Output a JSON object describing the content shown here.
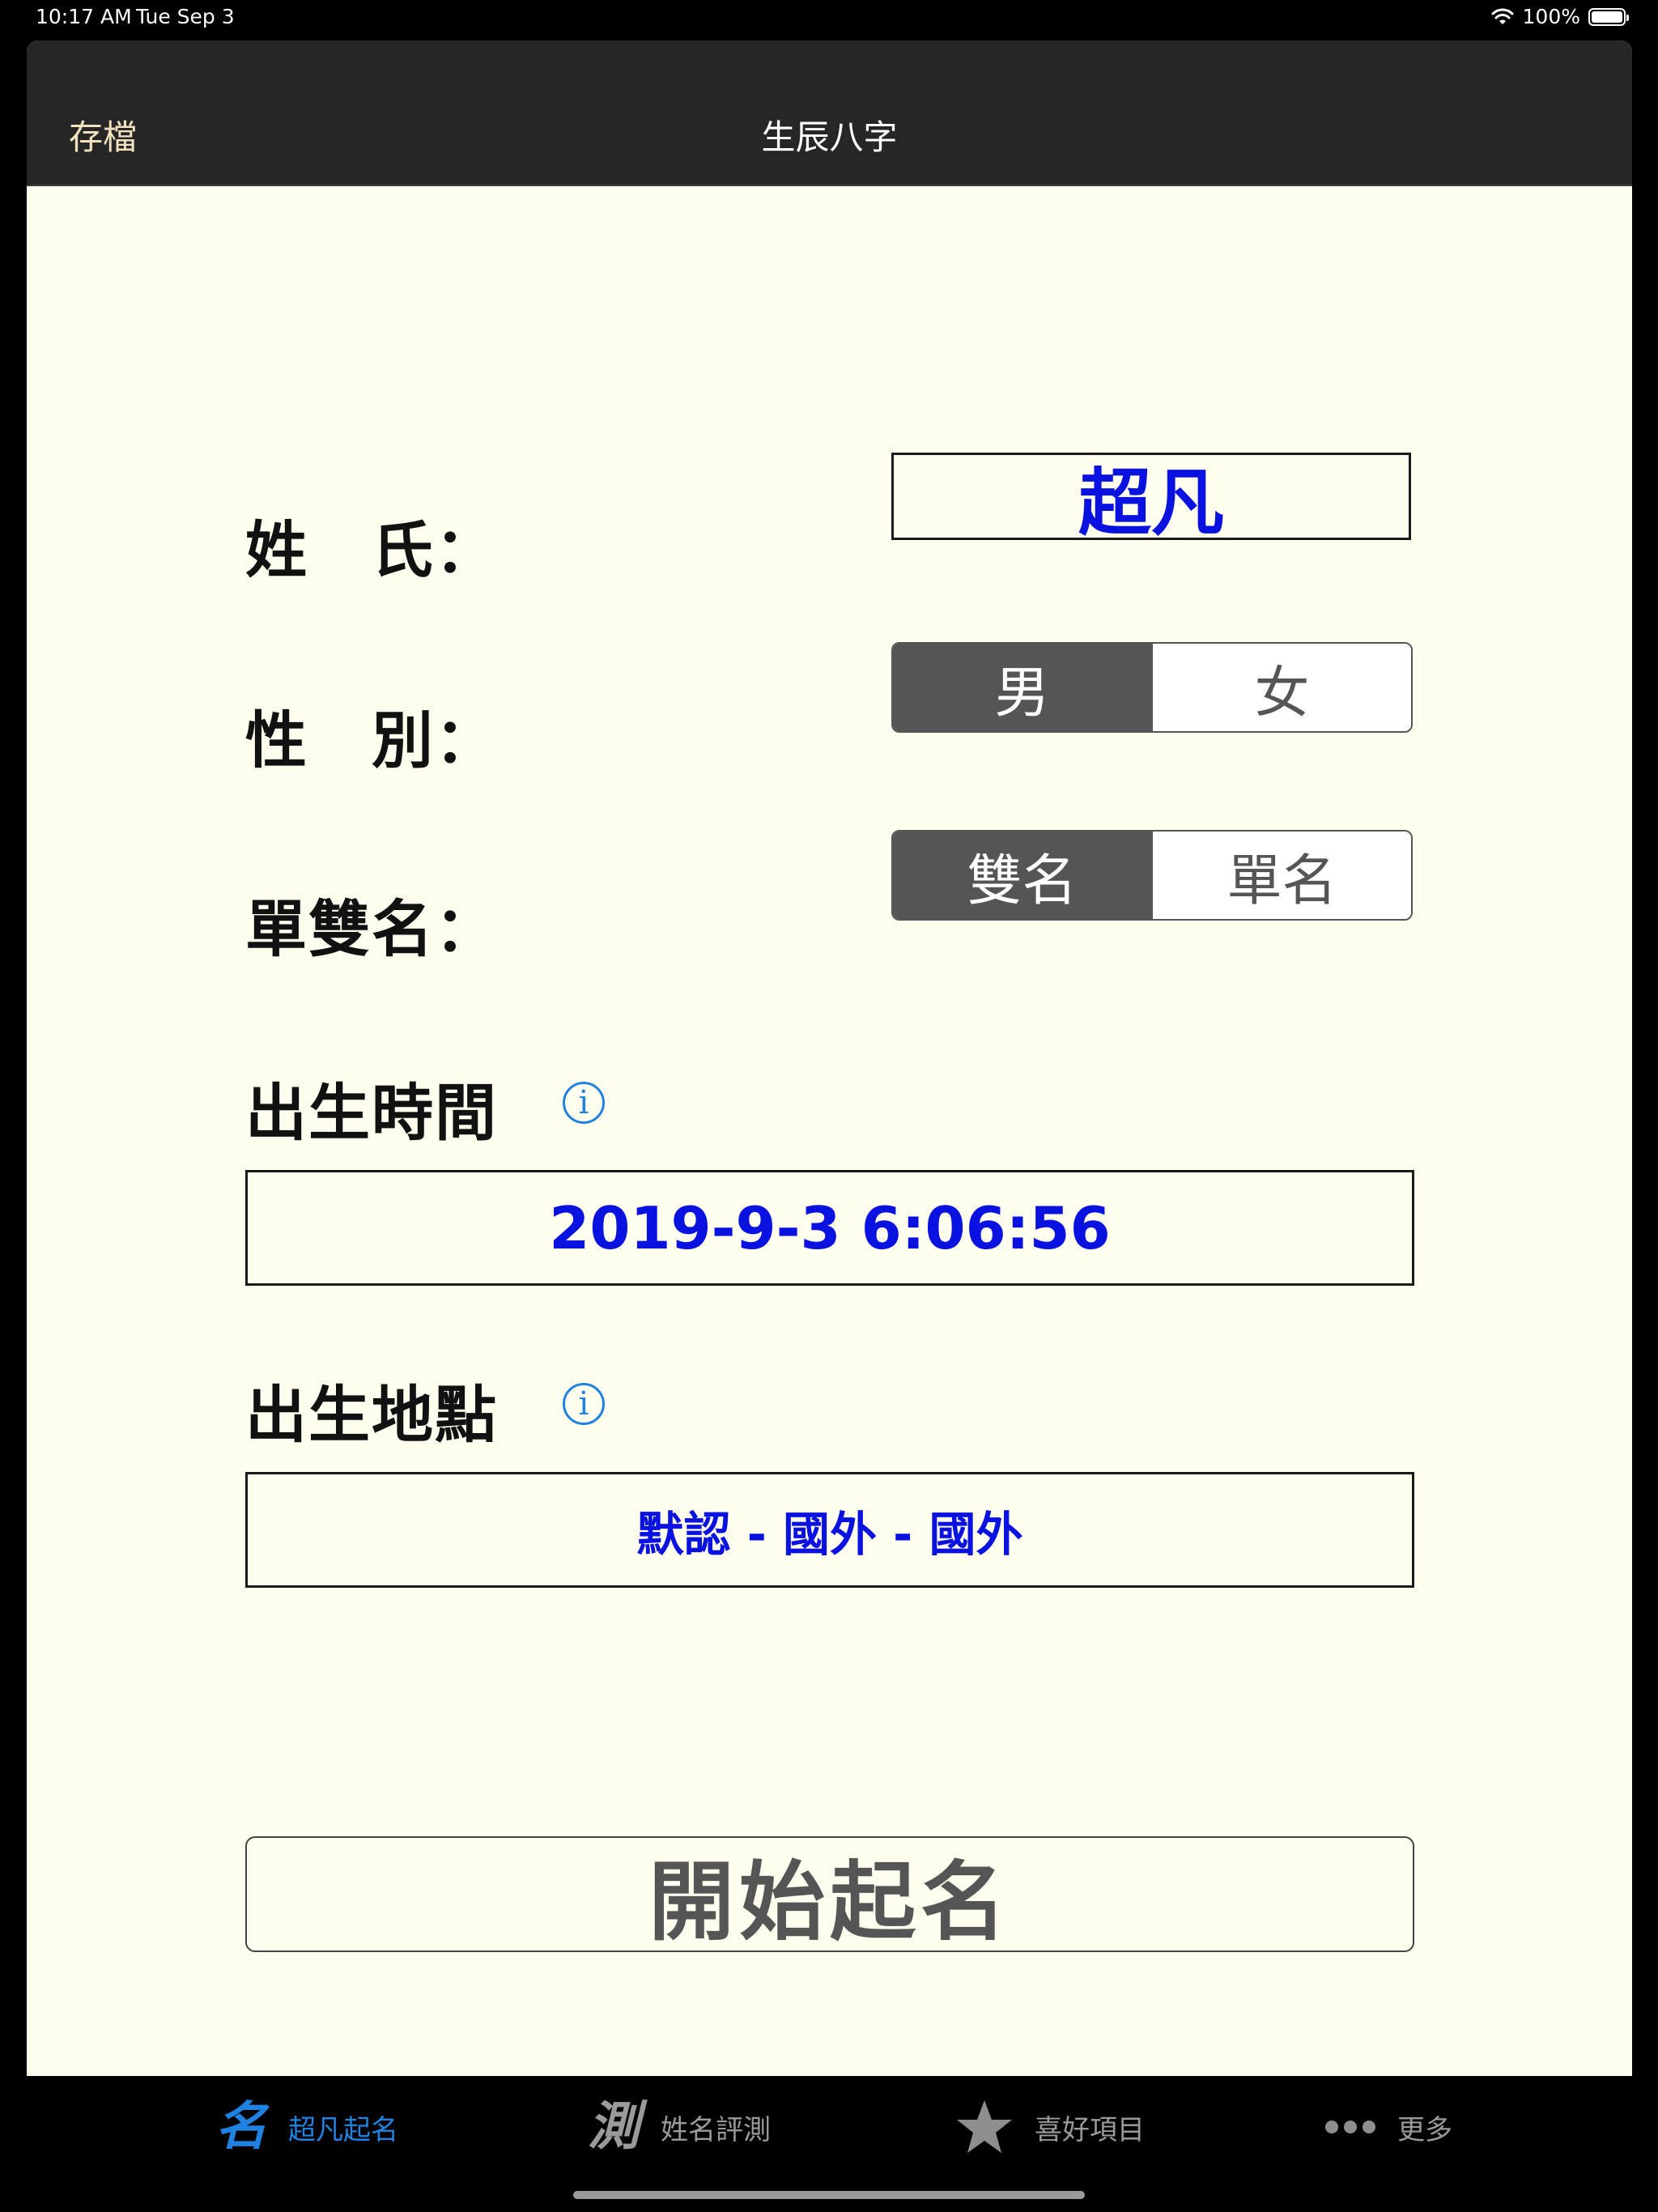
{
  "status_bar": {
    "time": "10:17 AM",
    "date": "Tue Sep 3",
    "battery": "100%",
    "icons": [
      "wifi-icon",
      "battery-icon"
    ]
  },
  "navbar": {
    "save_label": "存檔",
    "title": "生辰八字"
  },
  "form": {
    "surname_label": "姓　氏：",
    "surname_value": "超凡",
    "gender_label": "性　別：",
    "gender_options": [
      "男",
      "女"
    ],
    "gender_selected": "男",
    "name_type_label": "單雙名：",
    "name_type_options": [
      "雙名",
      "單名"
    ],
    "name_type_selected": "雙名",
    "birth_time_label": "出生時間",
    "birth_time_value": "2019-9-3 6:06:56",
    "birth_place_label": "出生地點",
    "birth_place_value": "默認 - 國外 - 國外",
    "start_button_label": "開始起名"
  },
  "tabbar": {
    "tabs": [
      {
        "icon": "名",
        "label": "超凡起名",
        "active": true
      },
      {
        "icon": "測",
        "label": "姓名評測",
        "active": false
      },
      {
        "icon": "star-icon",
        "label": "喜好項目",
        "active": false
      },
      {
        "icon": "more-icon",
        "label": "更多",
        "active": false
      }
    ]
  },
  "colors": {
    "accent": "#1f82e0",
    "value_blue": "#0a12e0",
    "background": "#fffdee",
    "navbar": "#262626",
    "segment_selected": "#555555"
  }
}
